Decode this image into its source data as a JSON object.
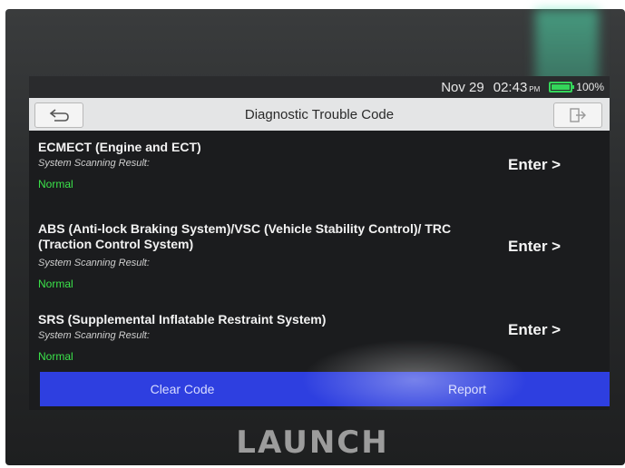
{
  "status_bar": {
    "date": "Nov 29",
    "time": "02:43",
    "ampm": "PM",
    "battery": "100%",
    "battery_level": 1.0
  },
  "header": {
    "title": "Diagnostic Trouble Code"
  },
  "systems": [
    {
      "name": "ECMECT (Engine and ECT)",
      "result_label": "System Scanning Result:",
      "status": "Normal",
      "enter_label": "Enter >"
    },
    {
      "name": "ABS (Anti-lock Braking System)/VSC (Vehicle Stability Control)/ TRC (Traction Control System)",
      "result_label": "System Scanning Result:",
      "status": "Normal",
      "enter_label": "Enter >"
    },
    {
      "name": "SRS (Supplemental Inflatable Restraint System)",
      "result_label": "System Scanning Result:",
      "status": "Normal",
      "enter_label": "Enter >"
    }
  ],
  "bottom_bar": {
    "clear_code": "Clear Code",
    "report": "Report"
  },
  "device": {
    "brand": "LAUNCH"
  },
  "colors": {
    "status_normal": "#3be34a",
    "bottom_bar": "#2e3fe0"
  }
}
